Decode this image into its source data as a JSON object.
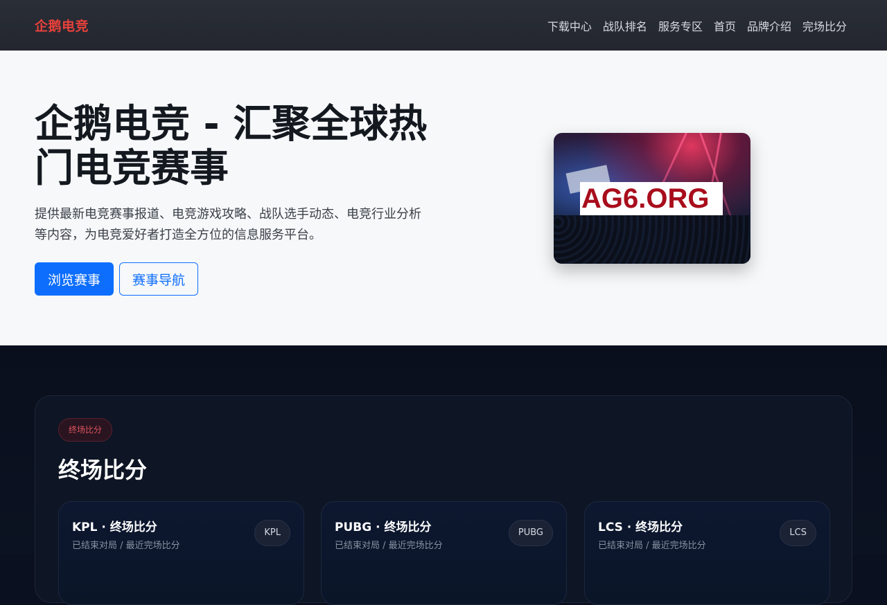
{
  "navbar": {
    "brand": "企鹅电竞",
    "items": [
      "下载中心",
      "战队排名",
      "服务专区",
      "首页",
      "品牌介绍",
      "完场比分"
    ]
  },
  "hero": {
    "title": "企鹅电竞 - 汇聚全球热门电竞赛事",
    "description": "提供最新电竞赛事报道、电竞游戏攻略、战队选手动态、电竞行业分析等内容，为电竞爱好者打造全方位的信息服务平台。",
    "primary_button": "浏览赛事",
    "secondary_button": "赛事导航",
    "image_watermark": "AG6.ORG"
  },
  "scores": {
    "badge": "终场比分",
    "title": "终场比分",
    "cards": [
      {
        "title": "KPL · 终场比分",
        "subtitle": "已结束对局 / 最近完场比分",
        "tag": "KPL"
      },
      {
        "title": "PUBG · 终场比分",
        "subtitle": "已结束对局 / 最近完场比分",
        "tag": "PUBG"
      },
      {
        "title": "LCS · 终场比分",
        "subtitle": "已结束对局 / 最近完场比分",
        "tag": "LCS"
      }
    ]
  },
  "colors": {
    "brand": "#e8413b",
    "primary": "#0d6efd",
    "navbar_bg": "#2a2e37",
    "hero_bg": "#f6f8fa",
    "dark_bg": "#0a0f1d"
  }
}
